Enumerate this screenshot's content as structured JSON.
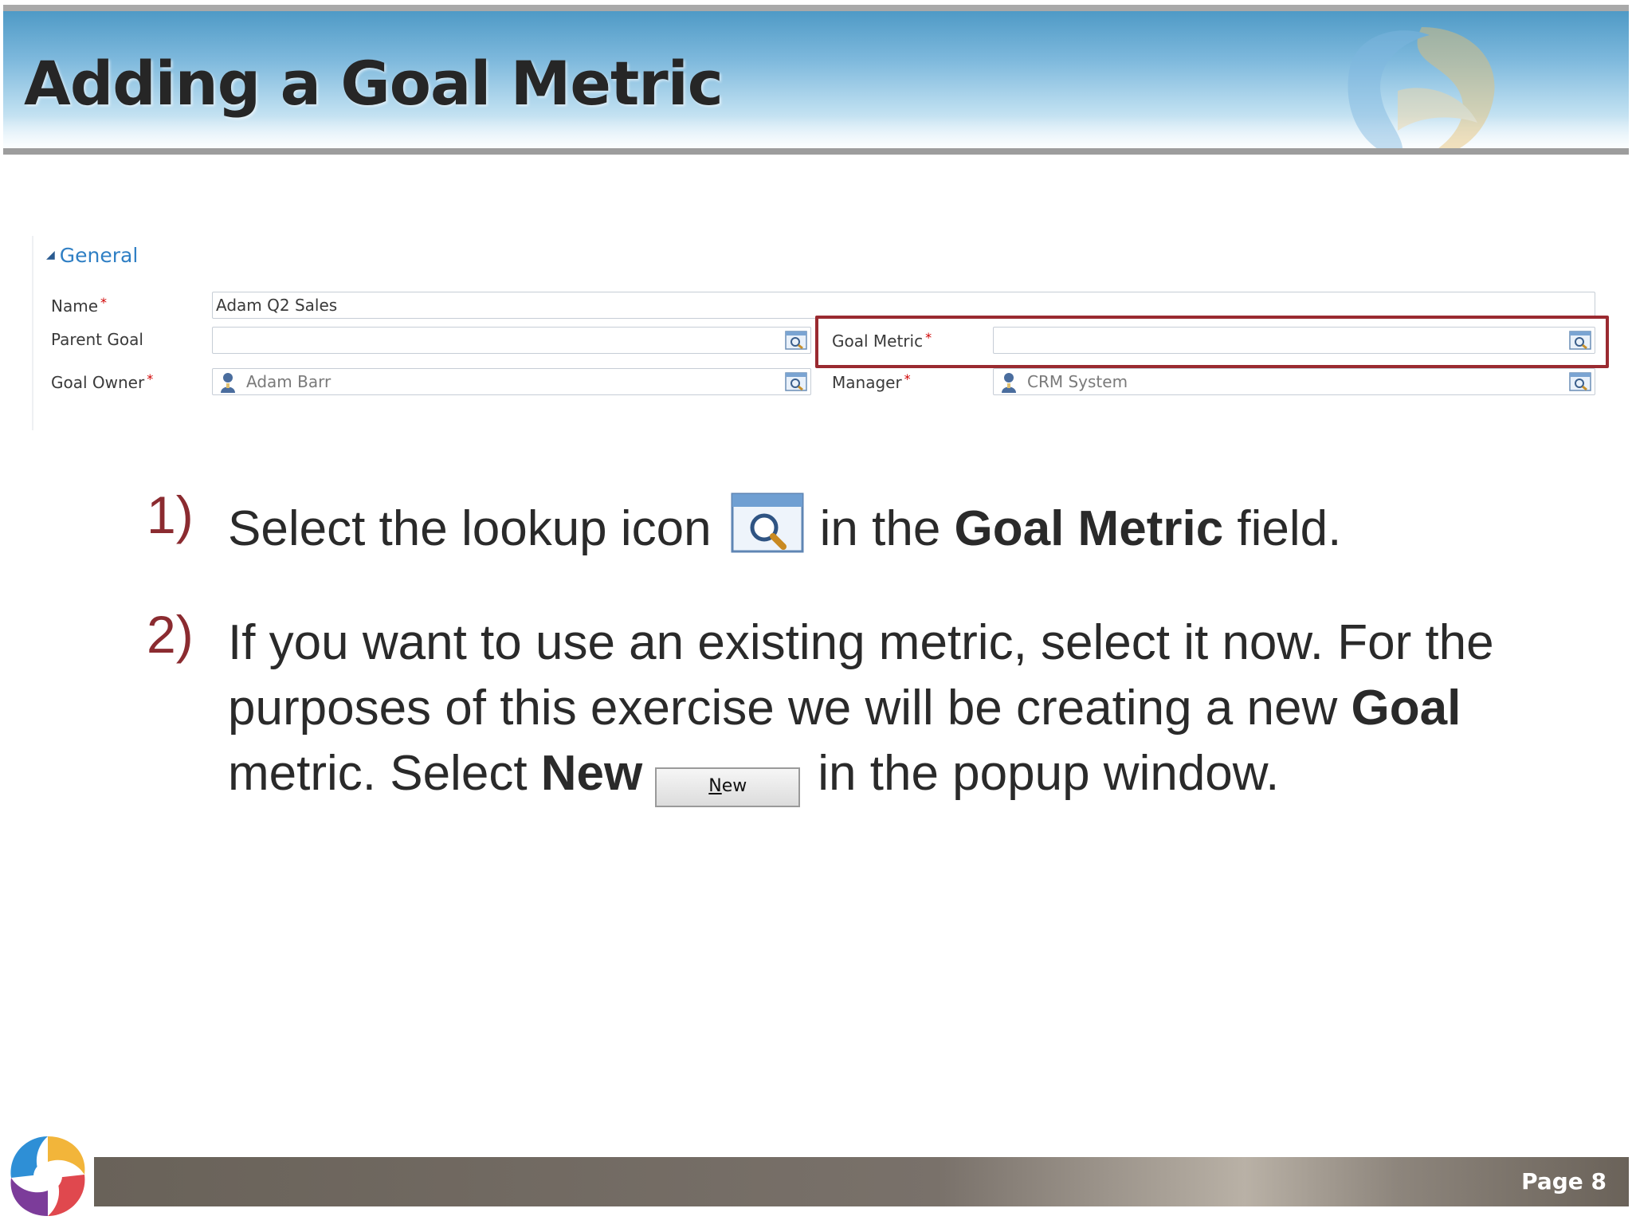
{
  "slide": {
    "title": "Adding a Goal Metric",
    "page_label": "Page 8"
  },
  "form": {
    "section_title": "General",
    "fields": {
      "name": {
        "label": "Name",
        "value": "Adam Q2 Sales"
      },
      "parent_goal": {
        "label": "Parent Goal",
        "value": ""
      },
      "goal_metric": {
        "label": "Goal Metric",
        "value": ""
      },
      "goal_owner": {
        "label": "Goal Owner",
        "value": "Adam Barr"
      },
      "manager": {
        "label": "Manager",
        "value": "CRM System"
      }
    },
    "required_marker": "*",
    "highlight_color": "#9a2a30"
  },
  "steps": [
    {
      "number": "1)",
      "text_before": "Select the lookup icon",
      "text_middle": "in the ",
      "bold": "Goal Metric",
      "text_after": " field."
    },
    {
      "number": "2)",
      "line1": "If you want to use an existing metric, select it now. For the",
      "line2_before": "purposes of this exercise we will be creating a new ",
      "line2_bold": "Goal",
      "line3_before": "metric. Select ",
      "line3_bold": "New",
      "new_button_label_first": "N",
      "new_button_label_rest": "ew",
      "line3_after": "in the popup window."
    }
  ],
  "colors": {
    "step_number": "#8b2b30",
    "section_title": "#2f7fc4"
  }
}
